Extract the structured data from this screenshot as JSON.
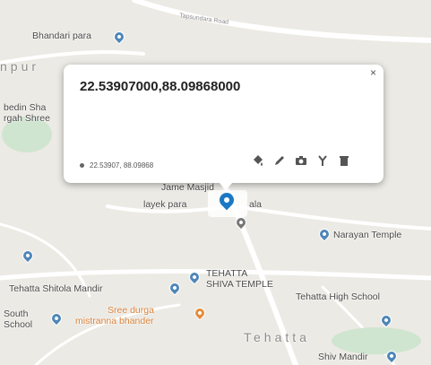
{
  "map": {
    "labels": {
      "bhandari_para": "Bhandari para",
      "npur": "npur",
      "bedin_sha": "bedin Sha",
      "rgah_shree": "rgah Shree",
      "road": "Tapsundara Road",
      "jame_masjid": "Jame Masjid",
      "layek_para": "layek para",
      "ala": "ala",
      "narayan_temple": "Narayan Temple",
      "tehatta_shitola": "Tehatta Shitola Mandir",
      "tehatta_shiva_1": "TEHATTA",
      "tehatta_shiva_2": "SHIVA TEMPLE",
      "tehatta_high_school": "Tehatta High School",
      "south_1": "South",
      "south_2": "School",
      "sree_durga_1": "Sree durga",
      "sree_durga_2": "mistranna bhander",
      "tehatta": "Tehatta",
      "shiv_mandir": "Shiv Mandir"
    }
  },
  "popup": {
    "title": "22.53907000,88.09868000",
    "close": "×",
    "coords": "22.53907, 88.09868",
    "tools": [
      "fill-icon",
      "pencil-icon",
      "camera-icon",
      "route-icon",
      "trash-icon"
    ]
  },
  "colors": {
    "pin": "#1b78c4",
    "poi": "#4e86b8",
    "food": "#e48c3c"
  }
}
